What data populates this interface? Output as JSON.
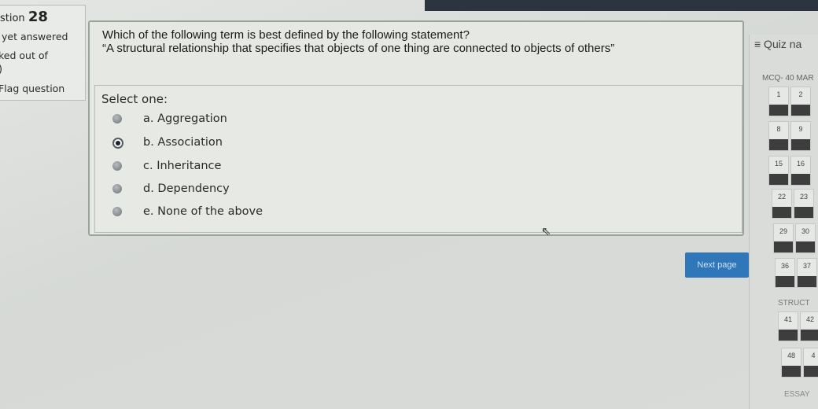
{
  "info": {
    "question_prefix": "stion",
    "question_number": "28",
    "status": "yet answered",
    "marked": "ked out of",
    "marks": ")",
    "flag": "Flag question"
  },
  "question": {
    "line1": "Which of the following term is best defined by the following statement?",
    "line2": "“A structural relationship that specifies that objects of one thing are connected to objects of others”",
    "select_label": "Select one:",
    "options": [
      {
        "label": "a. Aggregation",
        "selected": false
      },
      {
        "label": "b. Association",
        "selected": true
      },
      {
        "label": "c. Inheritance",
        "selected": false
      },
      {
        "label": "d. Dependency",
        "selected": false
      },
      {
        "label": "e. None of the above",
        "selected": false
      }
    ]
  },
  "next_label": "Next page",
  "quiz_nav": {
    "title": "≡ Quiz na",
    "section_mcq": "MCQ- 40 MAR",
    "section_struct": "STRUCT",
    "section_essay": "ESSAY",
    "buttons": [
      "1",
      "2",
      "8",
      "9",
      "15",
      "16",
      "22",
      "23",
      "29",
      "30",
      "36",
      "37",
      "41",
      "42",
      "48",
      "4"
    ]
  }
}
